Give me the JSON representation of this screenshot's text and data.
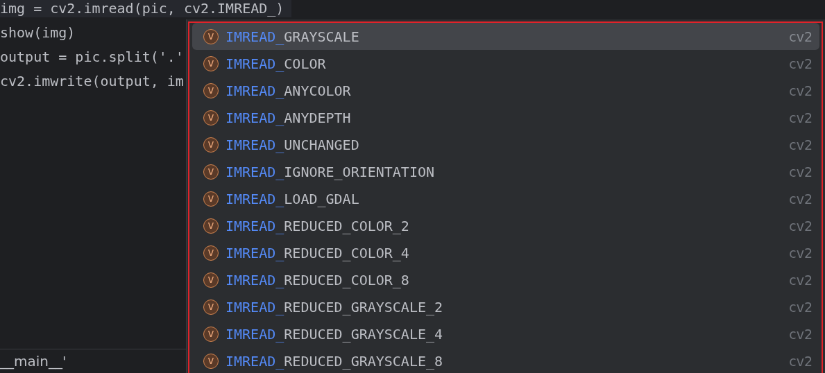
{
  "editor": {
    "lines": [
      {
        "text": "img = cv2.imread(pic, cv2.IMREAD_)",
        "current": true
      },
      {
        "text": "show(img)",
        "current": false
      },
      {
        "text": "output = pic.split('.'",
        "current": false
      },
      {
        "text": "cv2.imwrite(output, im",
        "current": false
      }
    ],
    "footer_line": "__main__'"
  },
  "completion_popup": {
    "items": [
      {
        "icon_letter": "v",
        "prefix": "IMREAD_",
        "name": "GRAYSCALE",
        "source": "cv2",
        "selected": true
      },
      {
        "icon_letter": "v",
        "prefix": "IMREAD_",
        "name": "COLOR",
        "source": "cv2",
        "selected": false
      },
      {
        "icon_letter": "v",
        "prefix": "IMREAD_",
        "name": "ANYCOLOR",
        "source": "cv2",
        "selected": false
      },
      {
        "icon_letter": "v",
        "prefix": "IMREAD_",
        "name": "ANYDEPTH",
        "source": "cv2",
        "selected": false
      },
      {
        "icon_letter": "v",
        "prefix": "IMREAD_",
        "name": "UNCHANGED",
        "source": "cv2",
        "selected": false
      },
      {
        "icon_letter": "v",
        "prefix": "IMREAD_",
        "name": "IGNORE_ORIENTATION",
        "source": "cv2",
        "selected": false
      },
      {
        "icon_letter": "v",
        "prefix": "IMREAD_",
        "name": "LOAD_GDAL",
        "source": "cv2",
        "selected": false
      },
      {
        "icon_letter": "v",
        "prefix": "IMREAD_",
        "name": "REDUCED_COLOR_2",
        "source": "cv2",
        "selected": false
      },
      {
        "icon_letter": "v",
        "prefix": "IMREAD_",
        "name": "REDUCED_COLOR_4",
        "source": "cv2",
        "selected": false
      },
      {
        "icon_letter": "v",
        "prefix": "IMREAD_",
        "name": "REDUCED_COLOR_8",
        "source": "cv2",
        "selected": false
      },
      {
        "icon_letter": "v",
        "prefix": "IMREAD_",
        "name": "REDUCED_GRAYSCALE_2",
        "source": "cv2",
        "selected": false
      },
      {
        "icon_letter": "v",
        "prefix": "IMREAD_",
        "name": "REDUCED_GRAYSCALE_4",
        "source": "cv2",
        "selected": false
      },
      {
        "icon_letter": "v",
        "prefix": "IMREAD_",
        "name": "REDUCED_GRAYSCALE_8",
        "source": "cv2",
        "selected": false
      }
    ]
  }
}
